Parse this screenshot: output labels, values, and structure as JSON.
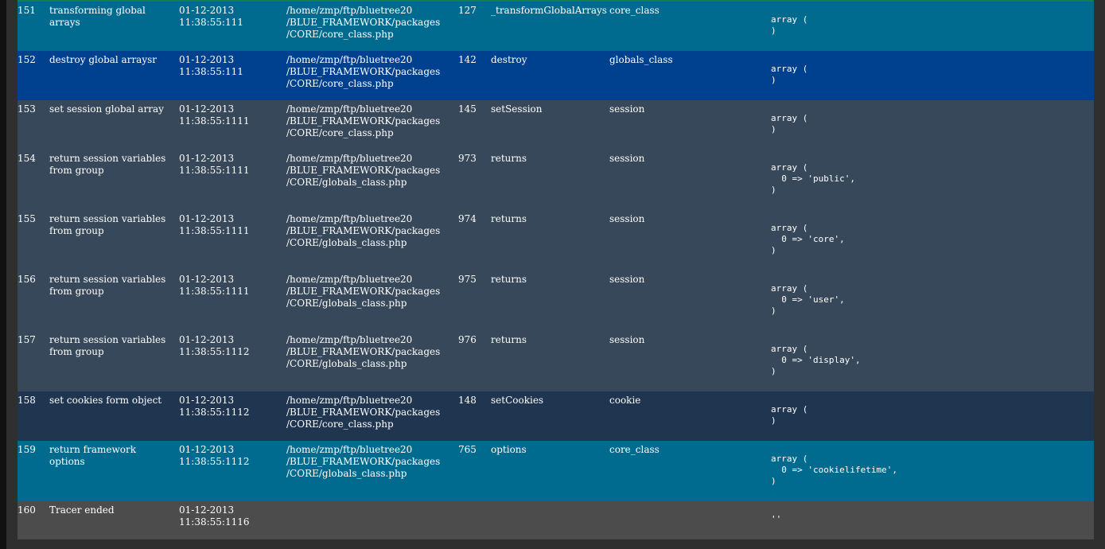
{
  "window": {
    "title": ""
  },
  "colors": {
    "teal": "#006b8f",
    "blue": "#00418f",
    "slate": "#37485a",
    "navy": "#1f3550",
    "gray": "#4c4c4c",
    "accent": "#12804c"
  },
  "rows": [
    {
      "index": "151",
      "message": "transforming global arrays",
      "time": "01-12-2013\n11:38:55:111",
      "file": "/home/zmp/ftp/bluetree20\n/BLUE_FRAMEWORK/packages\n/CORE/core_class.php",
      "line": "127",
      "function": "_transformGlobalArrays",
      "class": "core_class",
      "args": "array (\n)"
    },
    {
      "index": "152",
      "message": "destroy global arraysr",
      "time": "01-12-2013\n11:38:55:111",
      "file": "/home/zmp/ftp/bluetree20\n/BLUE_FRAMEWORK/packages\n/CORE/core_class.php",
      "line": "142",
      "function": "destroy",
      "class": "globals_class",
      "args": "array (\n)"
    },
    {
      "index": "153",
      "message": "set session global array",
      "time": "01-12-2013\n11:38:55:1111",
      "file": "/home/zmp/ftp/bluetree20\n/BLUE_FRAMEWORK/packages\n/CORE/core_class.php",
      "line": "145",
      "function": "setSession",
      "class": "session",
      "args": "array (\n)"
    },
    {
      "index": "154",
      "message": "return session variables from group",
      "time": "01-12-2013\n11:38:55:1111",
      "file": "/home/zmp/ftp/bluetree20\n/BLUE_FRAMEWORK/packages\n/CORE/globals_class.php",
      "line": "973",
      "function": "returns",
      "class": "session",
      "args": "array (\n  0 => 'public',\n)"
    },
    {
      "index": "155",
      "message": "return session variables from group",
      "time": "01-12-2013\n11:38:55:1111",
      "file": "/home/zmp/ftp/bluetree20\n/BLUE_FRAMEWORK/packages\n/CORE/globals_class.php",
      "line": "974",
      "function": "returns",
      "class": "session",
      "args": "array (\n  0 => 'core',\n)"
    },
    {
      "index": "156",
      "message": "return session variables from group",
      "time": "01-12-2013\n11:38:55:1111",
      "file": "/home/zmp/ftp/bluetree20\n/BLUE_FRAMEWORK/packages\n/CORE/globals_class.php",
      "line": "975",
      "function": "returns",
      "class": "session",
      "args": "array (\n  0 => 'user',\n)"
    },
    {
      "index": "157",
      "message": "return session variables from group",
      "time": "01-12-2013\n11:38:55:1112",
      "file": "/home/zmp/ftp/bluetree20\n/BLUE_FRAMEWORK/packages\n/CORE/globals_class.php",
      "line": "976",
      "function": "returns",
      "class": "session",
      "args": "array (\n  0 => 'display',\n)"
    },
    {
      "index": "158",
      "message": "set cookies form object",
      "time": "01-12-2013\n11:38:55:1112",
      "file": "/home/zmp/ftp/bluetree20\n/BLUE_FRAMEWORK/packages\n/CORE/core_class.php",
      "line": "148",
      "function": "setCookies",
      "class": "cookie",
      "args": "array (\n)"
    },
    {
      "index": "159",
      "message": "return framework options",
      "time": "01-12-2013\n11:38:55:1112",
      "file": "/home/zmp/ftp/bluetree20\n/BLUE_FRAMEWORK/packages\n/CORE/globals_class.php",
      "line": "765",
      "function": "options",
      "class": "core_class",
      "args": "array (\n  0 => 'cookielifetime',\n)"
    },
    {
      "index": "160",
      "message": "Tracer ended",
      "time": "01-12-2013\n11:38:55:1116",
      "file": "",
      "line": "",
      "function": "",
      "class": "",
      "args": "''"
    }
  ]
}
